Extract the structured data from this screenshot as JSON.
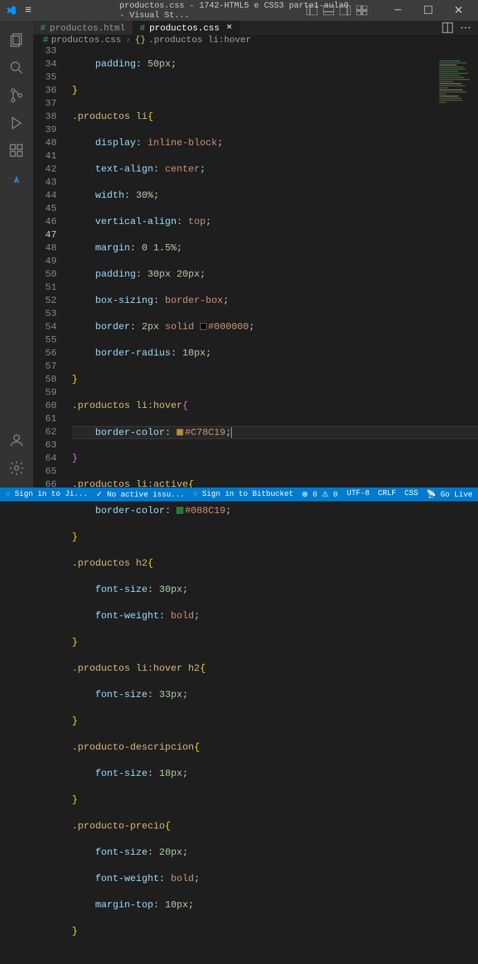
{
  "window": {
    "title": "productos.css - 1742-HTML5 e CSS3 parte1-aula0 - Visual St..."
  },
  "tabs": [
    {
      "label": "productos.html",
      "icon": "#"
    },
    {
      "label": "productos.css",
      "icon": "#"
    }
  ],
  "breadcrumb": {
    "file": "productos.css",
    "symbol": ".productos li:hover"
  },
  "lines": {
    "start": 33,
    "active": 47
  },
  "code": {
    "l33_prop": "padding",
    "l33_val": "50px",
    "l35_sel": ".productos li",
    "l36_prop": "display",
    "l36_val": "inline-block",
    "l37_prop": "text-align",
    "l37_val": "center",
    "l38_prop": "width",
    "l38_val": "30%",
    "l39_prop": "vertical-align",
    "l39_val": "top",
    "l40_prop": "margin",
    "l40_val": "0 1.5%",
    "l41_prop": "padding",
    "l41_val": "30px 20px",
    "l42_prop": "box-sizing",
    "l42_val": "border-box",
    "l43_prop": "border",
    "l43_v1": "2px",
    "l43_v2": "solid",
    "l43_color": "#000000",
    "l44_prop": "border-radius",
    "l44_val": "10px",
    "l46_sel": ".productos li:hover",
    "l47_prop": "border-color",
    "l47_color": "#C78C19",
    "l49_sel": ".productos li:active",
    "l50_prop": "border-color",
    "l50_color": "#088C19",
    "l52_sel": ".productos h2",
    "l53_prop": "font-size",
    "l53_val": "30px",
    "l54_prop": "font-weight",
    "l54_val": "bold",
    "l56_sel": ".productos li:hover h2",
    "l57_prop": "font-size",
    "l57_val": "33px",
    "l59_sel": ".producto-descripcion",
    "l60_prop": "font-size",
    "l60_val": "18px",
    "l62_sel": ".producto-precio",
    "l63_prop": "font-size",
    "l63_val": "20px",
    "l64_prop": "font-weight",
    "l64_val": "bold",
    "l65_prop": "margin-top",
    "l65_val": "10px"
  },
  "status": {
    "left1": "Sign in to Ji...",
    "left2": "No active issu...",
    "left3": "Sign in to Bitbucket",
    "errors": "0",
    "warnings": "0",
    "encoding": "UTF-8",
    "eol": "CRLF",
    "lang": "CSS",
    "golive": "Go Live"
  }
}
